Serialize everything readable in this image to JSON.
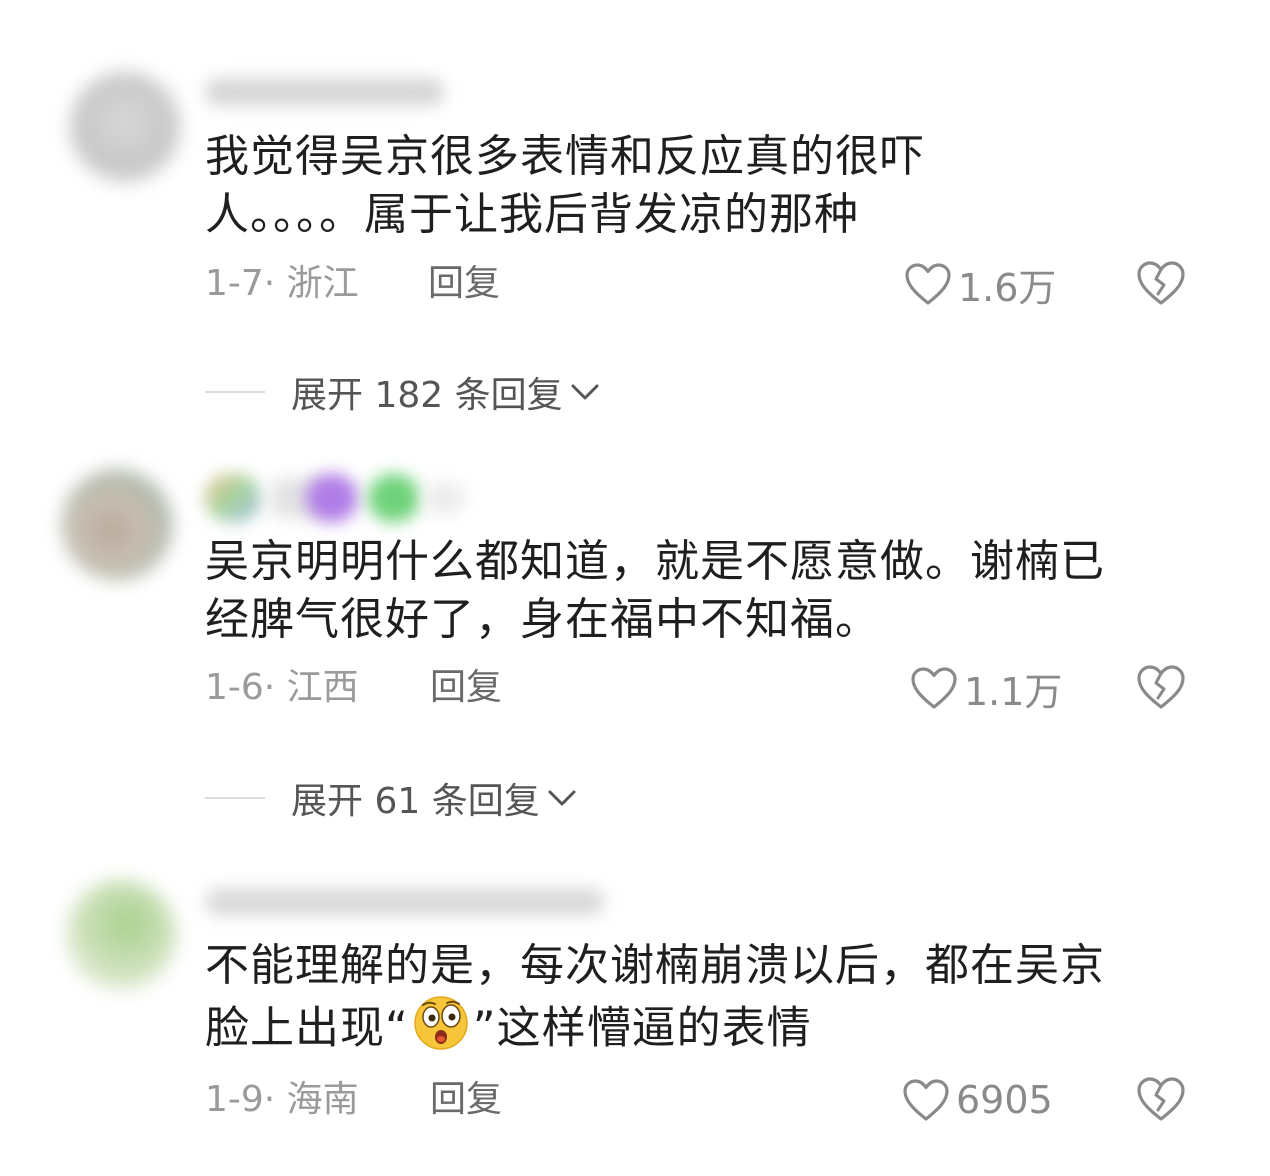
{
  "comments": [
    {
      "text_line1": "我觉得吴京很多表情和反应真的很吓",
      "text_line2": "人。。。。属于让我后背发凉的那种",
      "date_location": "1-7· 浙江",
      "reply_label": "回复",
      "like_count": "1.6万",
      "replies_label": "展开 182 条回复"
    },
    {
      "text_line1": "吴京明明什么都知道，就是不愿意做。谢楠已",
      "text_line2": "经脾气很好了，身在福中不知福。",
      "date_location": "1-6· 江西",
      "reply_label": "回复",
      "like_count": "1.1万",
      "replies_label": "展开 61 条回复"
    },
    {
      "text_line1": "不能理解的是，每次谢楠崩溃以后，都在吴京",
      "text_line2_before": "脸上出现“",
      "text_line2_after": "”这样懵逼的表情",
      "date_location": "1-9· 海南",
      "reply_label": "回复",
      "like_count": "6905"
    }
  ],
  "icons": {
    "like": "heart-outline-icon",
    "dislike": "broken-heart-icon",
    "expand": "chevron-down-icon",
    "emoji": "flushed-face-emoji-icon"
  },
  "colors": {
    "text": "#1f1f1f",
    "meta": "#9a9a9a",
    "reply": "#6a6a6a",
    "icon": "#8a8a8a"
  }
}
